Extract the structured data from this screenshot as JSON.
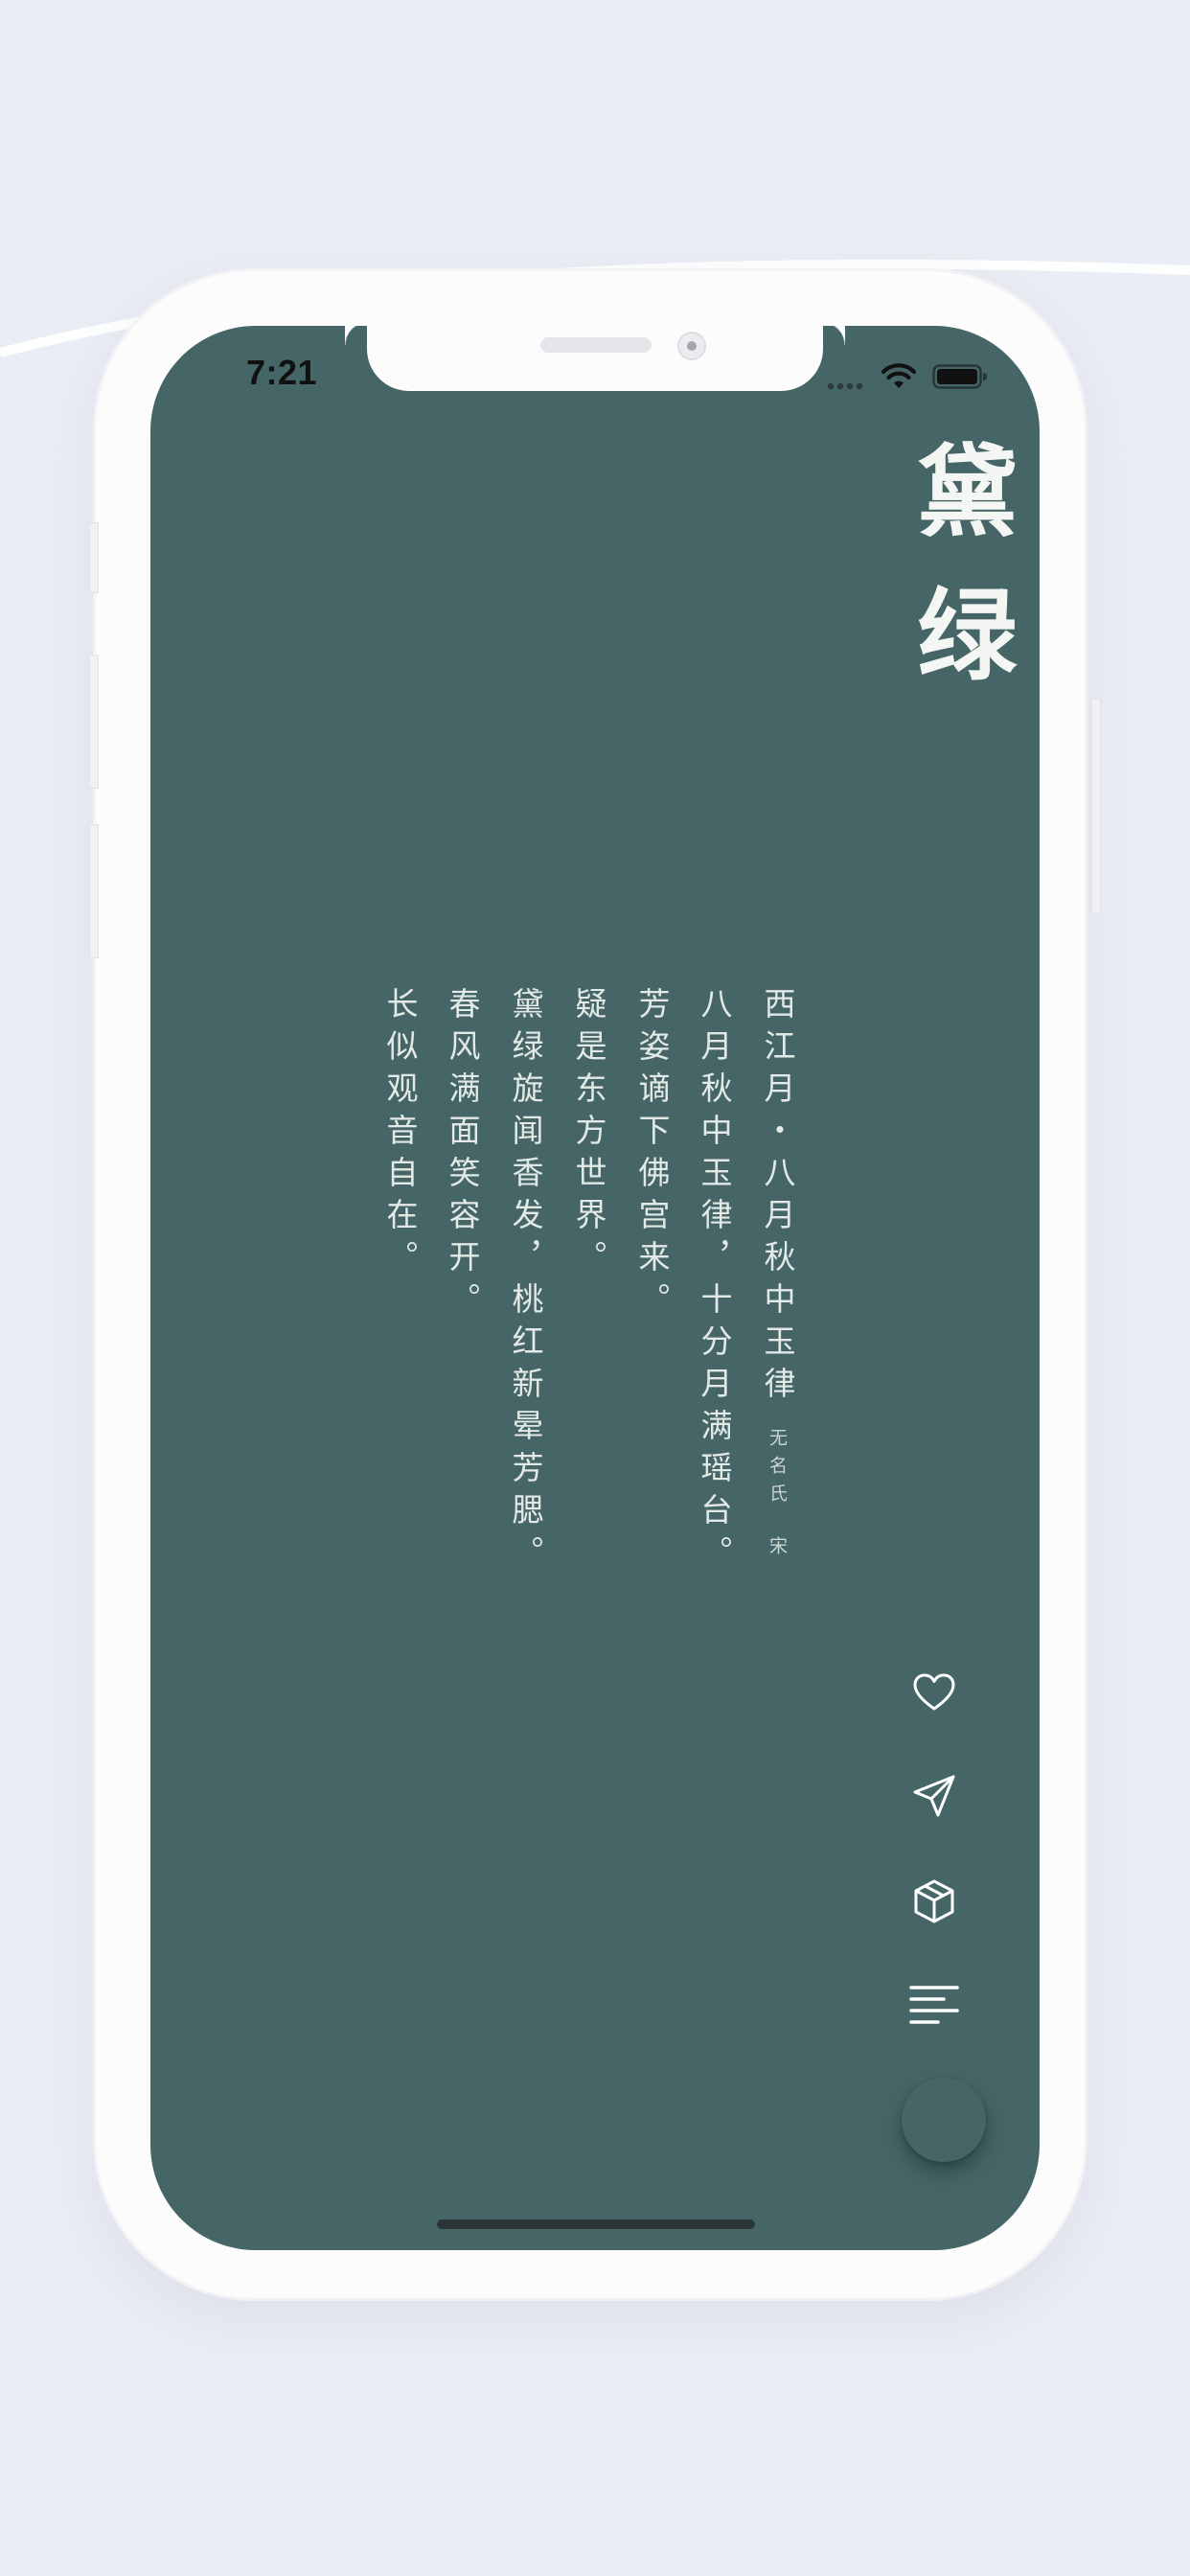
{
  "status_bar": {
    "time": "7:21"
  },
  "app": {
    "title": "黛绿",
    "theme_color": "#466566",
    "text_color": "#e2e9e6"
  },
  "poem": {
    "title": "西江月・八月秋中玉律",
    "author": "无名氏",
    "dynasty": "宋",
    "lines": [
      "八月秋中玉律，十分月满瑶台。",
      "芳姿谪下佛宫来。",
      "疑是东方世界。",
      "黛绿旋闻香发，桃红新晕芳腮。",
      "春风满面笑容开。",
      "长似观音自在。"
    ]
  },
  "actions": [
    {
      "icon": "heart-icon",
      "label": "like"
    },
    {
      "icon": "send-icon",
      "label": "share"
    },
    {
      "icon": "box-icon",
      "label": "collection"
    },
    {
      "icon": "menu-icon",
      "label": "menu"
    }
  ]
}
